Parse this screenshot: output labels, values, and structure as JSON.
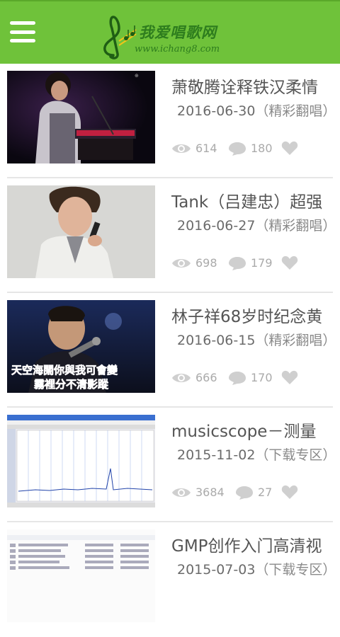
{
  "header": {
    "logo_title": "我爱唱歌网",
    "logo_url": "www.ichang8.com",
    "brand_color": "#6fc23a"
  },
  "items": [
    {
      "title": "萧敬腾诠释铁汉柔情",
      "date": "2016-06-30",
      "category": "（精彩翻唱）",
      "views": "614",
      "comments": "180",
      "thumb": "singer-piano-stage"
    },
    {
      "title": "Tank（吕建忠）超强",
      "date": "2016-06-27",
      "category": "（精彩翻唱）",
      "views": "698",
      "comments": "179",
      "thumb": "singer-portrait"
    },
    {
      "title": "林子祥68岁时纪念黄",
      "date": "2016-06-15",
      "category": "（精彩翻唱）",
      "views": "666",
      "comments": "170",
      "thumb": "concert-karaoke",
      "thumb_lyrics_line1": "天空海闊你與我可會變",
      "thumb_lyrics_line2": "霧裡分不清影蹤"
    },
    {
      "title": "musicscope－测量",
      "date": "2015-11-02",
      "category": "（下载专区）",
      "views": "3684",
      "comments": "27",
      "thumb": "software-spectrum"
    },
    {
      "title": "GMP创作入门高清视",
      "date": "2015-07-03",
      "category": "（下载专区）",
      "views": "",
      "comments": "",
      "thumb": "file-list"
    }
  ]
}
